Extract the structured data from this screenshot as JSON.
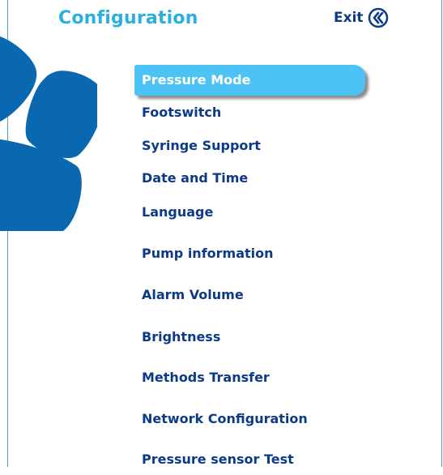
{
  "header": {
    "title": "Configuration",
    "exit_label": "Exit"
  },
  "colors": {
    "accent_light": "#4cc3f4",
    "title_color": "#2ab0de",
    "text_dark_blue": "#0d3a86",
    "decor_blue": "#0a68b0"
  },
  "menu": {
    "items": [
      {
        "label": "Pressure Mode",
        "selected": true
      },
      {
        "label": "Footswitch"
      },
      {
        "label": "Syringe Support"
      },
      {
        "label": "Date and Time"
      },
      {
        "label": "Language"
      },
      {
        "label": "Pump information"
      },
      {
        "label": "Alarm Volume"
      },
      {
        "label": "Brightness"
      },
      {
        "label": "Methods Transfer"
      },
      {
        "label": "Network Configuration"
      },
      {
        "label": "Pressure sensor Test"
      }
    ]
  }
}
